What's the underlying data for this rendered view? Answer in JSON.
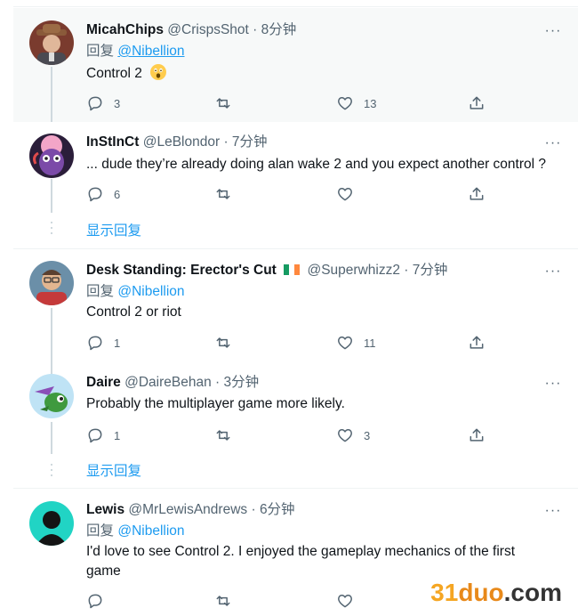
{
  "tweets": [
    {
      "name": "MicahChips",
      "handle": "@CrispsShot",
      "time": "8分钟",
      "reply_prefix": "回复",
      "reply_to": "@Nibellion",
      "text": "Control 2",
      "emoji": "astonished-face-emoji",
      "replies": "3",
      "retweets": "",
      "likes": "13"
    },
    {
      "name": "InStInCt",
      "handle": "@LeBlondor",
      "time": "7分钟",
      "text": "... dude they’re already doing alan wake 2 and you expect another control ?",
      "replies": "6",
      "retweets": "",
      "likes": ""
    },
    {
      "name": "Desk Standing: Erector's Cut",
      "flag": "irish-flag-emoji",
      "handle": "@Superwhizz2",
      "time": "7分钟",
      "reply_prefix": "回复",
      "reply_to": "@Nibellion",
      "text": "Control 2 or riot",
      "replies": "1",
      "retweets": "",
      "likes": "11"
    },
    {
      "name": "Daire",
      "handle": "@DaireBehan",
      "time": "3分钟",
      "text": "Probably the multiplayer game more likely.",
      "replies": "1",
      "retweets": "",
      "likes": "3"
    },
    {
      "name": "Lewis",
      "handle": "@MrLewisAndrews",
      "time": "6分钟",
      "reply_prefix": "回复",
      "reply_to": "@Nibellion",
      "text": "I'd love to see Control 2. I enjoyed the gameplay mechanics of the first game",
      "replies": "",
      "retweets": "",
      "likes": ""
    }
  ],
  "show_replies_label": "显示回复",
  "more_label": "···",
  "separator": "·",
  "watermark": {
    "part1": "31",
    "part2": "duo",
    "part3": ".com"
  },
  "colors": {
    "accent": "#1d9bf0",
    "muted": "#536471",
    "text": "#0f1419",
    "highlight_bg": "#f7f9f9"
  },
  "icons": {
    "reply": "reply-icon",
    "retweet": "retweet-icon",
    "like": "heart-icon",
    "share": "share-icon",
    "more": "more-icon"
  }
}
